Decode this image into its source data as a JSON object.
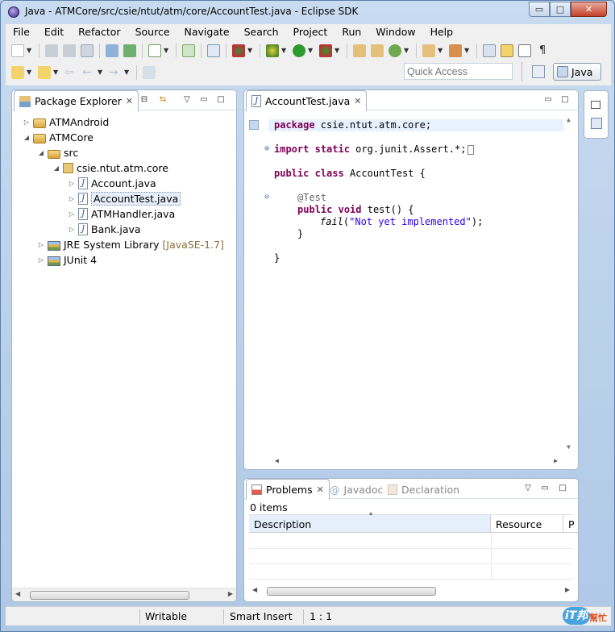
{
  "window": {
    "title": "Java - ATMCore/src/csie/ntut/atm/core/AccountTest.java - Eclipse SDK",
    "controls": {
      "minimize": "▭",
      "maximize": "□",
      "close": "✕"
    }
  },
  "menu": [
    "File",
    "Edit",
    "Refactor",
    "Source",
    "Navigate",
    "Search",
    "Project",
    "Run",
    "Window",
    "Help"
  ],
  "toolbar": {
    "quick_access_placeholder": "Quick Access",
    "perspective_label": "Java",
    "icons_row1": [
      "new-icon",
      "save-icon",
      "save-all-icon",
      "print-icon",
      "import-icon",
      "export-icon",
      "task-icon",
      "new-class-icon",
      "skip-breakpoints-icon",
      "debug-icon",
      "run-coverage-icon",
      "run-icon",
      "external-tools-icon",
      "new-package-icon",
      "new-class-icon",
      "new-java-icon",
      "open-type-icon",
      "search-icon",
      "toggle-mark-icon",
      "highlight-icon",
      "show-whitespace-icon",
      "pilcrow-icon"
    ],
    "icons_row2": [
      "next-annotation-icon",
      "prev-annotation-icon",
      "back-icon",
      "forward-icon",
      "pin-icon"
    ]
  },
  "package_explorer": {
    "tab_label": "Package Explorer",
    "tree": [
      {
        "label": "ATMAndroid",
        "icon": "project-icon",
        "expanded": false
      },
      {
        "label": "ATMCore",
        "icon": "project-icon",
        "expanded": true
      },
      {
        "label": "src",
        "icon": "source-folder-icon",
        "expanded": true
      },
      {
        "label": "csie.ntut.atm.core",
        "icon": "package-icon",
        "expanded": true
      },
      {
        "label": "Account.java",
        "icon": "java-file-icon"
      },
      {
        "label": "AccountTest.java",
        "icon": "java-file-icon",
        "selected": true
      },
      {
        "label": "ATMHandler.java",
        "icon": "java-file-icon"
      },
      {
        "label": "Bank.java",
        "icon": "java-file-icon"
      },
      {
        "label": "JRE System Library",
        "decoration": "[JavaSE-1.7]",
        "icon": "library-icon",
        "expanded": false
      },
      {
        "label": "JUnit 4",
        "icon": "library-icon",
        "expanded": false
      }
    ]
  },
  "editor": {
    "tab_label": "AccountTest.java",
    "code": {
      "l1_kw": "package",
      "l1_rest": " csie.ntut.atm.core;",
      "l2_kw1": "import",
      "l2_kw2": "static",
      "l2_rest": " org.junit.Assert.*;",
      "l3_kw1": "public",
      "l3_kw2": "class",
      "l3_rest": " AccountTest {",
      "l4_ann": "@Test",
      "l5_kw1": "public",
      "l5_kw2": "void",
      "l5_rest": " test() {",
      "l6_fn": "fail",
      "l6_open": "(",
      "l6_str": "\"Not yet implemented\"",
      "l6_close": ");",
      "l7": "}",
      "l8": "}"
    }
  },
  "bottom": {
    "tabs": [
      "Problems",
      "Javadoc",
      "Declaration"
    ],
    "count": "0 items",
    "columns": [
      "Description",
      "Resource",
      "P"
    ]
  },
  "status": {
    "writable": "Writable",
    "insert_mode": "Smart Insert",
    "position": "1 : 1"
  },
  "watermark": {
    "logo": "iT邦",
    "text": "幫忙"
  },
  "colors": {
    "keyword": "#7f0055",
    "string": "#2a00ff",
    "annotation": "#646464",
    "selection": "#e7effa"
  }
}
